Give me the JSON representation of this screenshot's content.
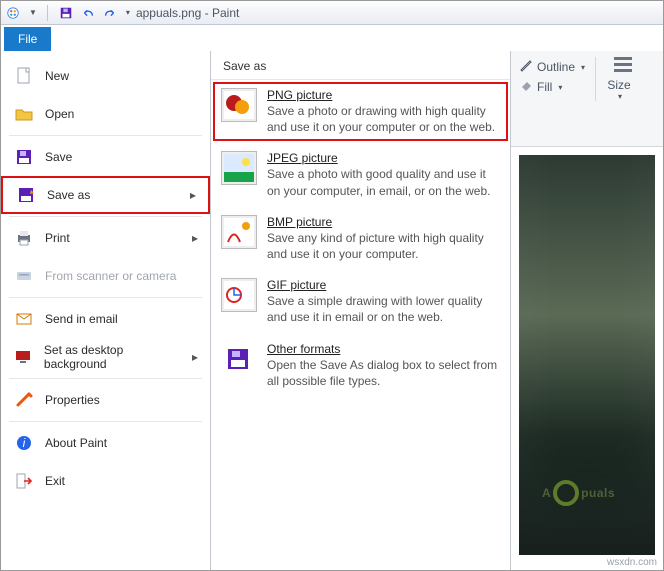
{
  "title": "appuals.png - Paint",
  "file_tab": "File",
  "menu": {
    "new": "New",
    "open": "Open",
    "save": "Save",
    "save_as": "Save as",
    "print": "Print",
    "scanner": "From scanner or camera",
    "email": "Send in email",
    "background": "Set as desktop background",
    "properties": "Properties",
    "about": "About Paint",
    "exit": "Exit"
  },
  "saveas": {
    "header": "Save as",
    "items": [
      {
        "title": "PNG picture",
        "desc": "Save a photo or drawing with high quality and use it on your computer or on the web."
      },
      {
        "title": "JPEG picture",
        "desc": "Save a photo with good quality and use it on your computer, in email, or on the web."
      },
      {
        "title": "BMP picture",
        "desc": "Save any kind of picture with high quality and use it on your computer."
      },
      {
        "title": "GIF picture",
        "desc": "Save a simple drawing with lower quality and use it in email or on the web."
      },
      {
        "title": "Other formats",
        "desc": "Open the Save As dialog box to select from all possible file types."
      }
    ]
  },
  "ribbon": {
    "outline": "Outline",
    "fill": "Fill",
    "size": "Size"
  },
  "watermark": {
    "left": "A",
    "right": "puals"
  },
  "credit": "wsxdn.com"
}
